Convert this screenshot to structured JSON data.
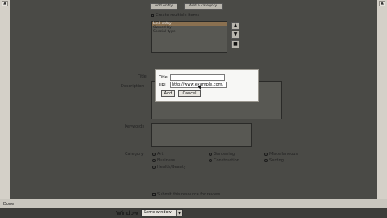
{
  "toolbar": {
    "add_entry_label": "Add entry",
    "add_category_label": "Add a category"
  },
  "create_multiple": {
    "label": "Create multiple items"
  },
  "listbox": {
    "items": [
      {
        "label": "Link entry",
        "selected": true
      },
      {
        "label": "Owned by",
        "selected": false
      },
      {
        "label": "Special type",
        "selected": false
      }
    ],
    "up_arrow": "▲",
    "down_arrow": "▼",
    "remove_glyph": "■"
  },
  "form": {
    "title_label": "Title",
    "description_label": "Description",
    "keywords_label": "Keywords",
    "category_label": "Category",
    "categories": [
      "Art",
      "Gardening",
      "Miscellaneous",
      "Business",
      "Construction",
      "Surfing",
      "Health/Beauty"
    ],
    "submit_checkbox_label": "Submit this resource for review"
  },
  "dialog": {
    "title_label": "Title",
    "url_label": "URL",
    "url_value": "http://www.example.com/",
    "add_label": "Add",
    "cancel_label": "Cancel"
  },
  "status": {
    "text": "Done"
  },
  "window": {
    "label": "Window",
    "value": "Same window"
  }
}
